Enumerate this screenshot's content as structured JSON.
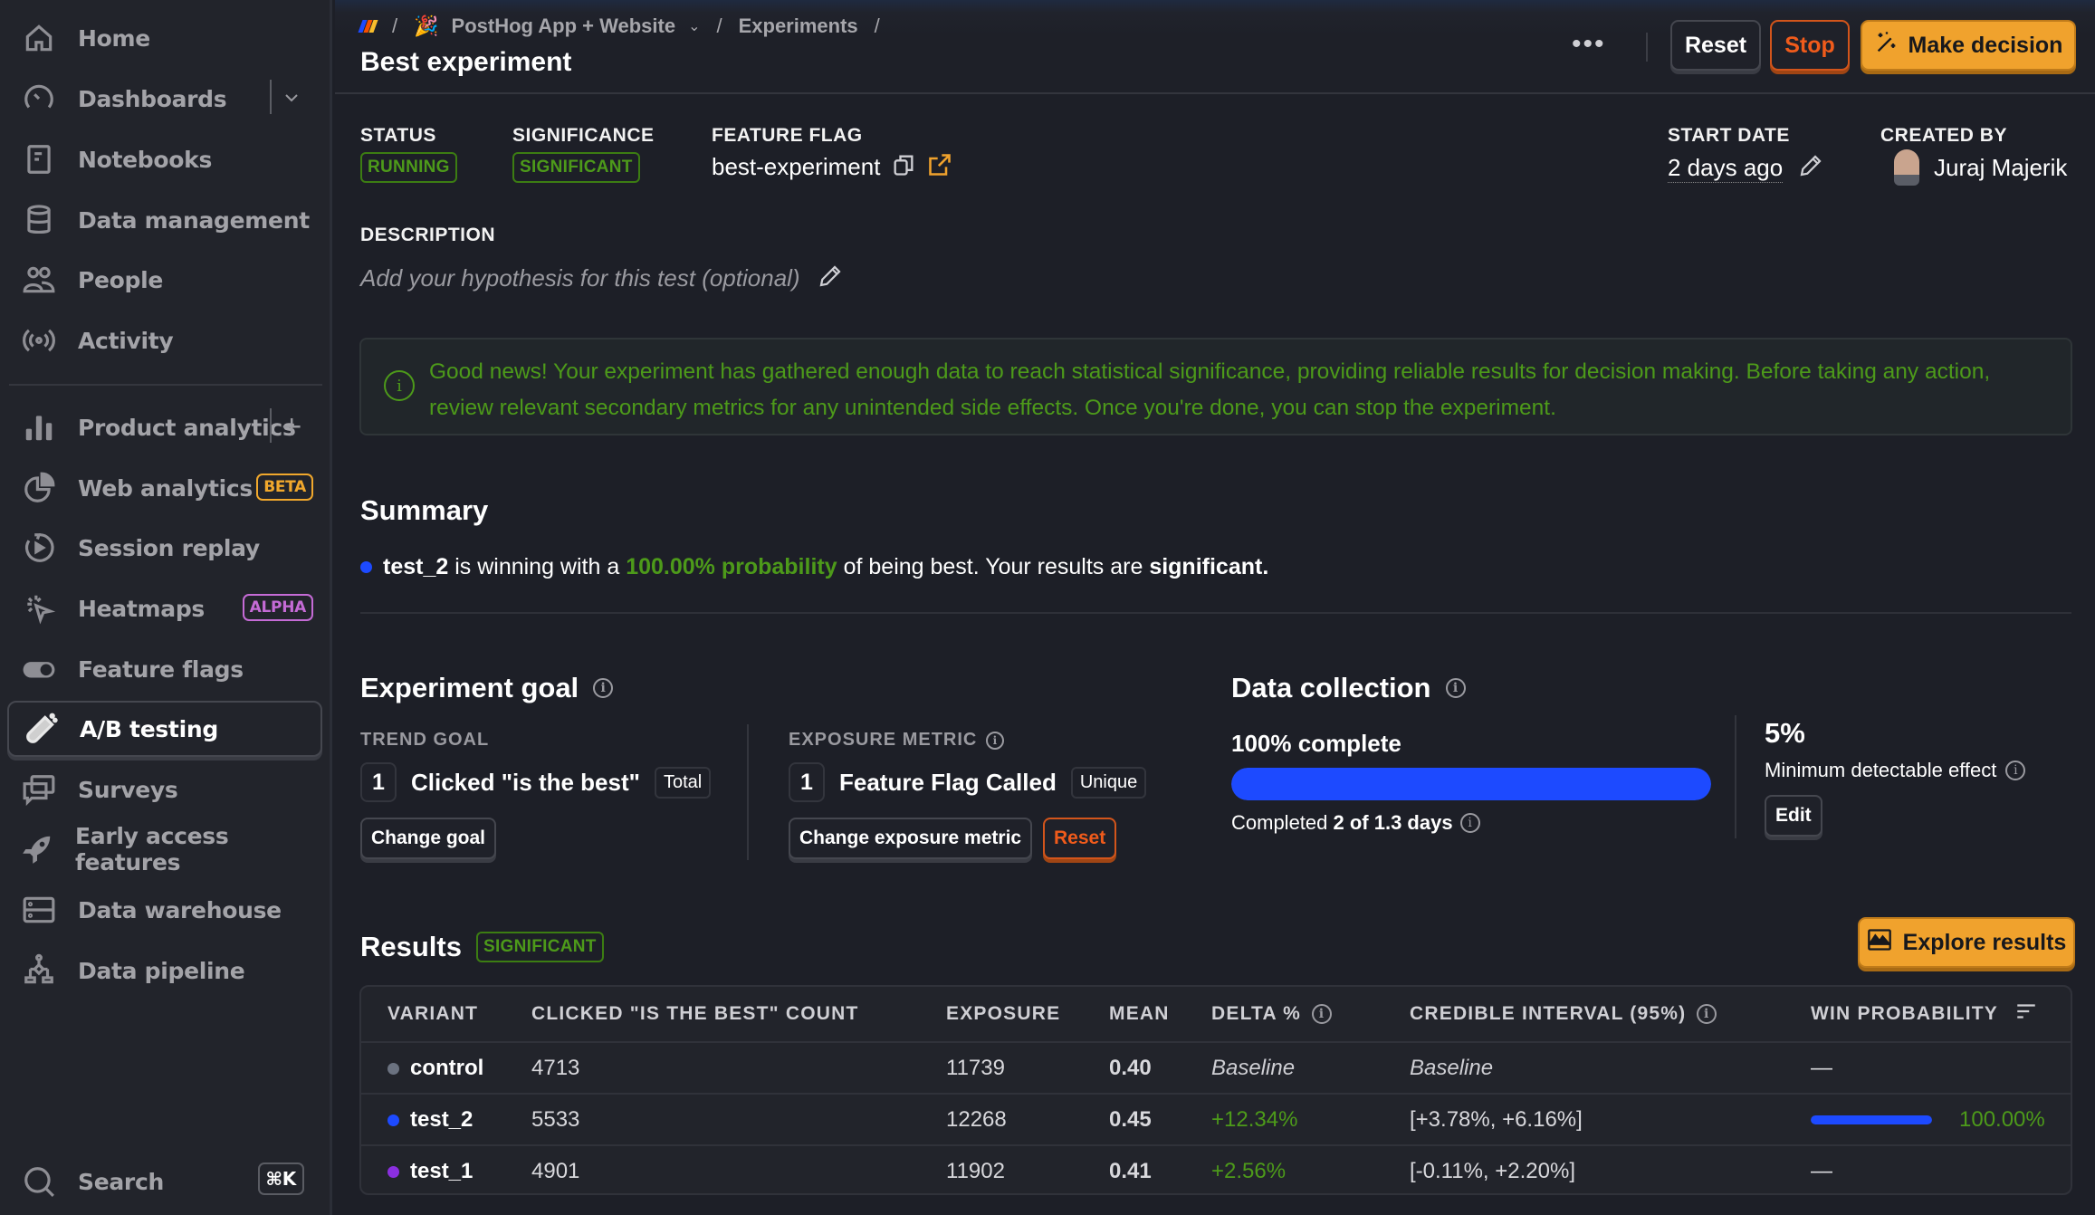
{
  "sidebar": {
    "items": [
      {
        "label": "Home",
        "icon": "home-icon"
      },
      {
        "label": "Dashboards",
        "icon": "gauge-icon",
        "trail": "chevron-down-icon"
      },
      {
        "label": "Notebooks",
        "icon": "notebook-icon"
      },
      {
        "label": "Data management",
        "icon": "database-icon"
      },
      {
        "label": "People",
        "icon": "people-icon"
      },
      {
        "label": "Activity",
        "icon": "broadcast-icon"
      },
      {
        "label": "Product analytics",
        "icon": "bar-chart-icon",
        "trail": "plus-icon"
      },
      {
        "label": "Web analytics",
        "icon": "pie-chart-icon",
        "badge": "BETA"
      },
      {
        "label": "Session replay",
        "icon": "replay-icon"
      },
      {
        "label": "Heatmaps",
        "icon": "cursor-click-icon",
        "badge": "ALPHA"
      },
      {
        "label": "Feature flags",
        "icon": "toggle-icon"
      },
      {
        "label": "A/B testing",
        "icon": "flask-icon",
        "active": true
      },
      {
        "label": "Surveys",
        "icon": "chat-bubbles-icon"
      },
      {
        "label": "Early access features",
        "icon": "rocket-icon"
      },
      {
        "label": "Data warehouse",
        "icon": "server-icon"
      },
      {
        "label": "Data pipeline",
        "icon": "pipeline-icon"
      }
    ],
    "search": {
      "label": "Search",
      "shortcut": "⌘K"
    }
  },
  "header": {
    "breadcrumbs": [
      "PostHog App + Website",
      "Experiments"
    ],
    "title": "Best experiment",
    "more_label": "•••",
    "buttons": {
      "reset": "Reset",
      "stop": "Stop",
      "make_decision": "Make decision"
    }
  },
  "meta": {
    "status": {
      "label": "STATUS",
      "value": "RUNNING"
    },
    "significance": {
      "label": "SIGNIFICANCE",
      "value": "SIGNIFICANT"
    },
    "feature_flag": {
      "label": "FEATURE FLAG",
      "value": "best-experiment"
    },
    "start_date": {
      "label": "START DATE",
      "value": "2 days ago"
    },
    "created_by": {
      "label": "CREATED BY",
      "value": "Juraj Majerik"
    },
    "description": {
      "label": "DESCRIPTION",
      "placeholder": "Add your hypothesis for this test (optional)"
    }
  },
  "banner": {
    "text": "Good news! Your experiment has gathered enough data to reach statistical significance, providing reliable results for decision making. Before taking any action, review relevant secondary metrics for any unintended side effects. Once you're done, you can stop the experiment."
  },
  "summary": {
    "title": "Summary",
    "variant": "test_2",
    "text_1": " is winning with a ",
    "probability": "100.00% probability",
    "text_2": " of being best. Your results are ",
    "significant": "significant."
  },
  "goal": {
    "title": "Experiment goal",
    "trend_label": "TREND GOAL",
    "trend_index": "1",
    "trend_event": "Clicked \"is the best\"",
    "trend_math": "Total",
    "change_goal": "Change goal",
    "exposure_label": "EXPOSURE METRIC",
    "exposure_index": "1",
    "exposure_event": "Feature Flag Called",
    "exposure_math": "Unique",
    "change_exposure": "Change exposure metric",
    "reset": "Reset"
  },
  "data_collection": {
    "title": "Data collection",
    "complete_label": "100% complete",
    "progress": 1.0,
    "completed_prefix": "Completed ",
    "completed_value": "2 of 1.3 days",
    "mde_value": "5%",
    "mde_label": "Minimum detectable effect",
    "edit": "Edit"
  },
  "results": {
    "title": "Results",
    "badge": "SIGNIFICANT",
    "explore": "Explore results",
    "columns": [
      "VARIANT",
      "CLICKED \"IS THE BEST\" COUNT",
      "EXPOSURE",
      "MEAN",
      "DELTA %",
      "CREDIBLE INTERVAL (95%)",
      "WIN PROBABILITY"
    ],
    "rows": [
      {
        "variant": "control",
        "color": "#6b7280",
        "count": "4713",
        "exposure": "11739",
        "mean": "0.40",
        "delta": "Baseline",
        "interval": "Baseline",
        "win": "—",
        "win_fraction": null
      },
      {
        "variant": "test_2",
        "color": "#1d4aff",
        "count": "5533",
        "exposure": "12268",
        "mean": "0.45",
        "delta": "+12.34%",
        "interval": "[+3.78%, +6.16%]",
        "win": "100.00%",
        "win_fraction": 1.0
      },
      {
        "variant": "test_1",
        "color": "#8b2fe0",
        "count": "4901",
        "exposure": "11902",
        "mean": "0.41",
        "delta": "+2.56%",
        "interval": "[-0.11%, +2.20%]",
        "win": "—",
        "win_fraction": null
      }
    ]
  },
  "colors": {
    "accent": "#f0a22d",
    "danger": "#f05b1b",
    "success": "#4d9a1a",
    "primary_blue": "#1d4aff"
  }
}
